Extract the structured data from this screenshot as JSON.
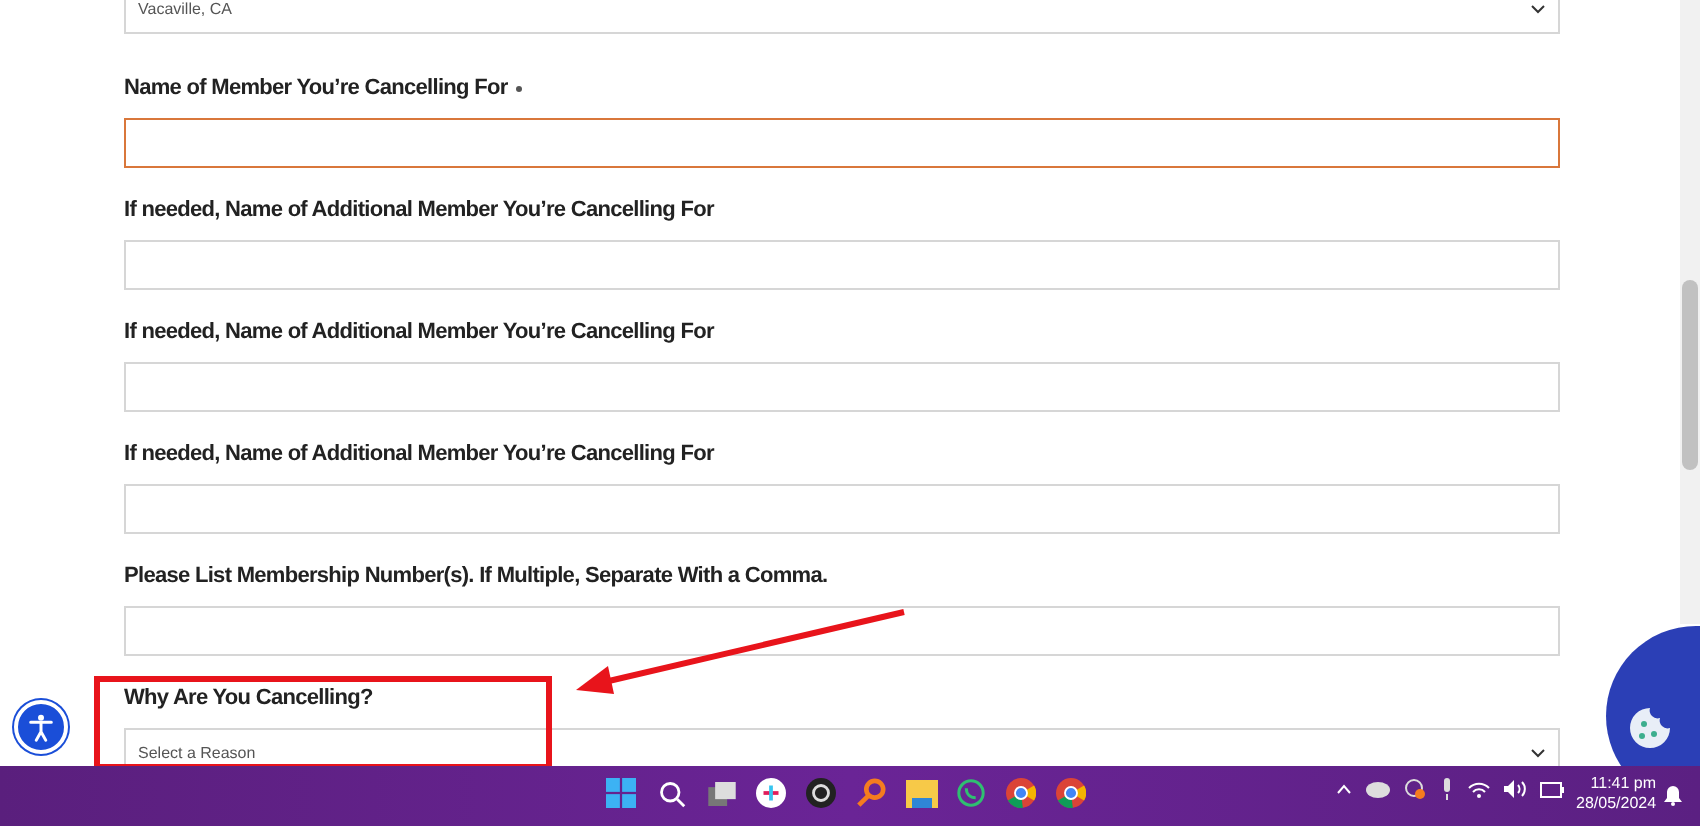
{
  "location_select": {
    "value": "Vacaville, CA"
  },
  "fields": [
    {
      "label": "Name of Member You’re Cancelling For",
      "required": true,
      "focused": true
    },
    {
      "label": "If needed, Name of Additional Member You’re Cancelling For",
      "required": false,
      "focused": false
    },
    {
      "label": "If needed, Name of Additional Member You’re Cancelling For",
      "required": false,
      "focused": false
    },
    {
      "label": "If needed, Name of Additional Member You’re Cancelling For",
      "required": false,
      "focused": false
    },
    {
      "label": "Please List Membership Number(s). If Multiple, Separate With a Comma.",
      "required": false,
      "focused": false
    }
  ],
  "reason_select": {
    "label": "Why Are You Cancelling?",
    "value": "Select a Reason"
  },
  "taskbar": {
    "time": "11:41 pm",
    "date": "28/05/2024"
  }
}
